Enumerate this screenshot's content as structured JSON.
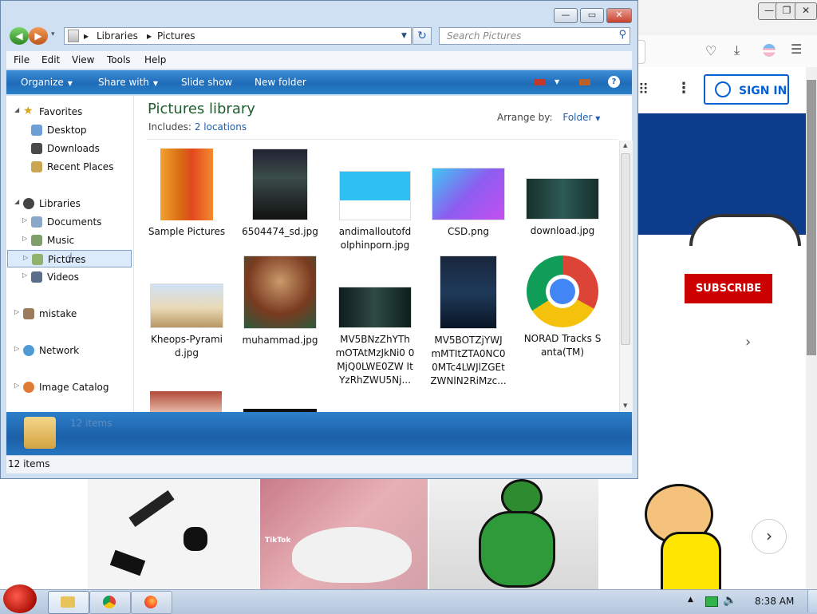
{
  "explorer": {
    "address": {
      "segments": [
        "Libraries",
        "Pictures"
      ]
    },
    "search": {
      "placeholder": "Search Pictures"
    },
    "menu": [
      "File",
      "Edit",
      "View",
      "Tools",
      "Help"
    ],
    "commands": {
      "organize": "Organize",
      "share_with": "Share with",
      "slide_show": "Slide show",
      "new_folder": "New folder",
      "help": "?"
    },
    "nav": {
      "favorites": "Favorites",
      "desktop": "Desktop",
      "downloads": "Downloads",
      "recent_places": "Recent Places",
      "libraries": "Libraries",
      "documents": "Documents",
      "music": "Music",
      "pictures": "Pictures",
      "videos": "Videos",
      "mistake": "mistake",
      "network": "Network",
      "image_catalog": "Image Catalog"
    },
    "library": {
      "title": "Pictures library",
      "includes_label": "Includes:",
      "includes_link": "2 locations",
      "arrange_label": "Arrange by:",
      "arrange_value": "Folder"
    },
    "items": [
      "Sample Pictures",
      "6504474_sd.jpg",
      "andimalloutofd olphinporn.jpg",
      "CSD.png",
      "download.jpg",
      "Kheops-Pyrami d.jpg",
      "muhammad.jpg",
      "MV5BNzZhYTh mOTAtMzJkNi0 0MjQ0LWE0ZW ItYzRhZWU5Nj...",
      "MV5BOTZjYWJ mMTItZTA0NC0 0MTc4LWJlZGEt ZWNlN2RiMzc...",
      "NORAD Tracks Santa(TM)"
    ],
    "details_count": "12 items",
    "status": "12 items"
  },
  "browser": {
    "sign_in": "SIGN IN",
    "subscribe": "SUBSCRIBE",
    "tiktok": "TikTok"
  },
  "taskbar": {
    "time": "8:38 AM"
  },
  "colors": {
    "command_bar": "#1f6cb8",
    "library_title": "#1e5e2e",
    "link": "#1d5fb5",
    "subscribe": "#cc0000",
    "signin": "#065fd4"
  }
}
